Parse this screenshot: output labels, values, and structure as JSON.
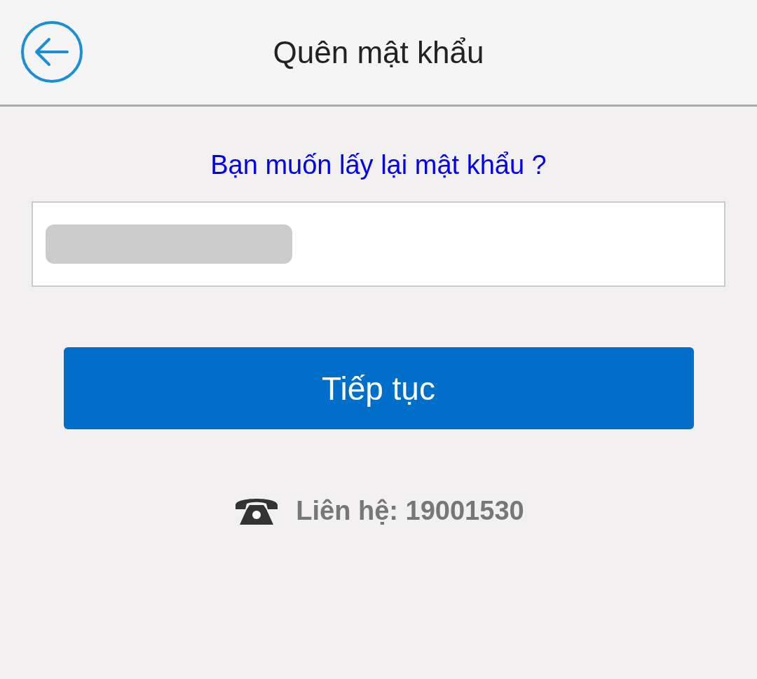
{
  "header": {
    "title": "Quên mật khẩu"
  },
  "prompt": "Bạn muốn lấy lại mật khẩu ?",
  "field": {
    "redacted": true
  },
  "button": {
    "label": "Tiếp tục"
  },
  "contact": {
    "label": "Liên hệ: 19001530"
  }
}
